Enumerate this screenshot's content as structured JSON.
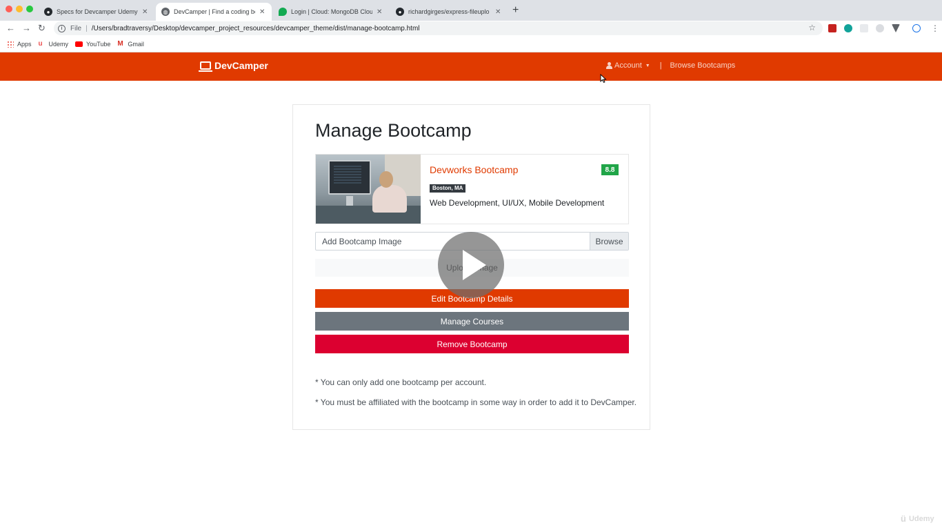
{
  "browser": {
    "tabs": [
      {
        "title": "Specs for Devcamper Udemy c",
        "active": false,
        "icon": "github-icon"
      },
      {
        "title": "DevCamper | Find a coding bo",
        "active": true,
        "icon": "globe-icon"
      },
      {
        "title": "Login | Cloud: MongoDB Cloud",
        "active": false,
        "icon": "mongodb-leaf-icon"
      },
      {
        "title": "richardgirges/express-fileuplo",
        "active": false,
        "icon": "github-icon"
      }
    ],
    "address": {
      "scheme_label": "File",
      "url": "/Users/bradtraversy/Desktop/devcamper_project_resources/devcamper_theme/dist/manage-bootcamp.html"
    },
    "bookmarks": [
      {
        "label": "Apps",
        "icon": "apps-grid-icon"
      },
      {
        "label": "Udemy",
        "icon": "udemy-icon"
      },
      {
        "label": "YouTube",
        "icon": "youtube-icon"
      },
      {
        "label": "Gmail",
        "icon": "gmail-icon"
      }
    ]
  },
  "navbar": {
    "brand": "DevCamper",
    "account_label": "Account",
    "divider": "|",
    "browse_label": "Browse Bootcamps"
  },
  "page": {
    "title": "Manage Bootcamp",
    "bootcamp": {
      "name": "Devworks Bootcamp",
      "rating": "8.8",
      "location": "Boston, MA",
      "careers": "Web Development, UI/UX, Mobile Development"
    },
    "file_input": {
      "label": "Add Bootcamp Image",
      "browse": "Browse"
    },
    "upload_button": "Upload Image",
    "buttons": {
      "edit": "Edit Bootcamp Details",
      "courses": "Manage Courses",
      "remove": "Remove Bootcamp"
    },
    "notes": [
      "* You can only add one bootcamp per account.",
      "* You must be affiliated with the bootcamp in some way in order to add it to DevCamper."
    ]
  },
  "overlay": {
    "watermark": "Udemy"
  },
  "colors": {
    "brand": "#e03a00",
    "rating_badge": "#20a548",
    "secondary": "#6c757d",
    "danger": "#dc0030"
  }
}
